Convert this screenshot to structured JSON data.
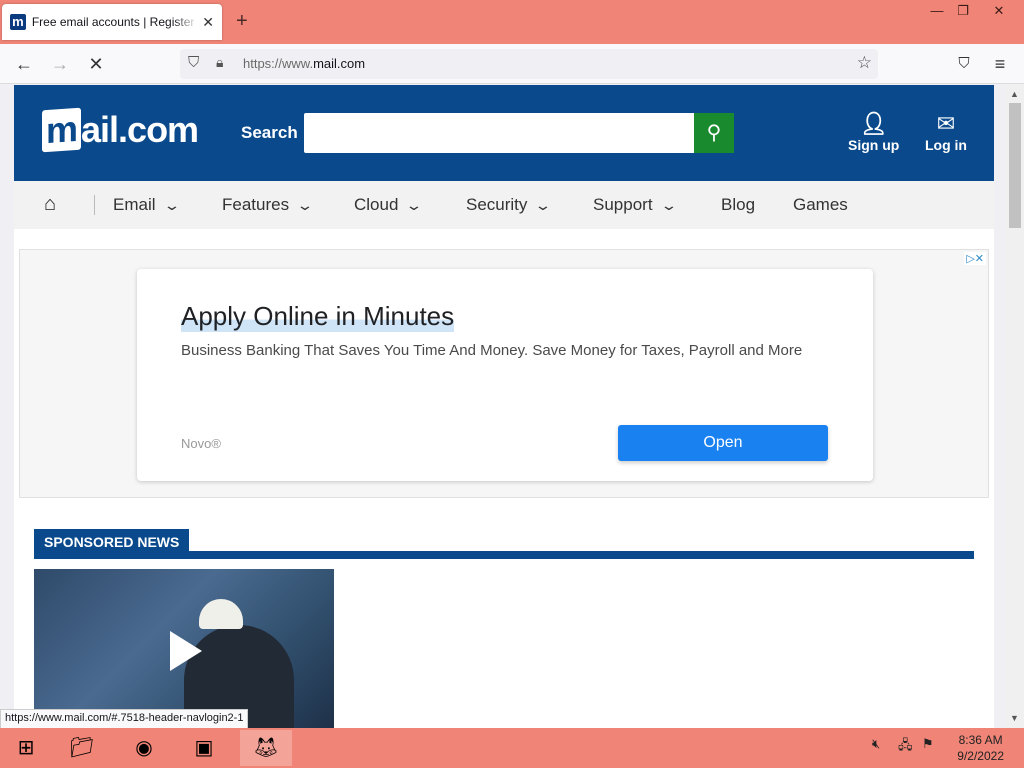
{
  "browser": {
    "tab_title": "Free email accounts | Register to",
    "tab_favicon": "m",
    "new_tab": "+",
    "url_prefix": "https://www.",
    "url_domain": "mail.com",
    "status_url": "https://www.mail.com/#.7518-header-navlogin2-1"
  },
  "header": {
    "logo": "mail.com",
    "search_label": "Search",
    "sign_up": "Sign up",
    "log_in": "Log in"
  },
  "nav": {
    "items": [
      "Email",
      "Features",
      "Cloud",
      "Security",
      "Support",
      "Blog",
      "Games"
    ]
  },
  "ad": {
    "title": "Apply Online in Minutes",
    "description": "Business Banking That Saves You Time And Money. Save Money for Taxes, Payroll and More",
    "brand": "Novo®",
    "cta": "Open"
  },
  "sponsored": {
    "heading": "SPONSORED NEWS"
  },
  "taskbar": {
    "time": "8:36 AM",
    "date": "9/2/2022"
  },
  "colors": {
    "brand_blue": "#0a4a8c",
    "search_green": "#1a8a2e",
    "cta_blue": "#1a82f0",
    "titlebar": "#f08577"
  }
}
